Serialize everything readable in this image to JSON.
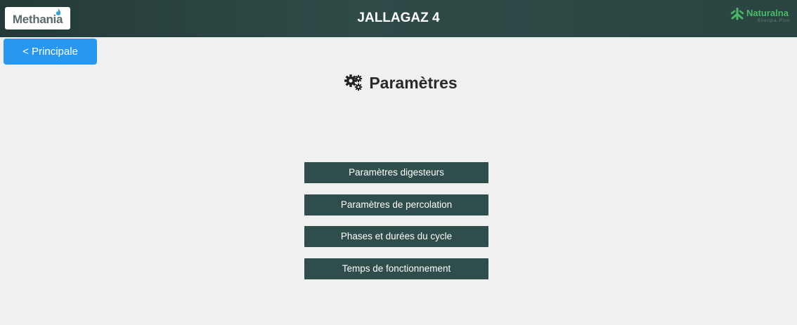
{
  "header": {
    "title": "JALLAGAZ 4",
    "logo_left": {
      "text": "Methania",
      "icon": "methania-logo"
    },
    "logo_right": {
      "name": "Naturalna",
      "subtitle": "Energia.Plus",
      "icon": "naturalna-logo"
    }
  },
  "nav": {
    "back_label": "< Principale"
  },
  "page": {
    "icon": "gears-icon",
    "heading": "Paramètres"
  },
  "menu": {
    "items": [
      {
        "label": "Paramètres digesteurs"
      },
      {
        "label": "Paramètres de percolation"
      },
      {
        "label": "Phases et durées du cycle"
      },
      {
        "label": "Temps de fonctionnement"
      }
    ]
  },
  "colors": {
    "header_bg": "#2f4b48",
    "primary_button": "#2897ef",
    "menu_button": "#2f4d4a",
    "page_bg": "#f0f0f0",
    "brand_green": "#4cb86a"
  }
}
